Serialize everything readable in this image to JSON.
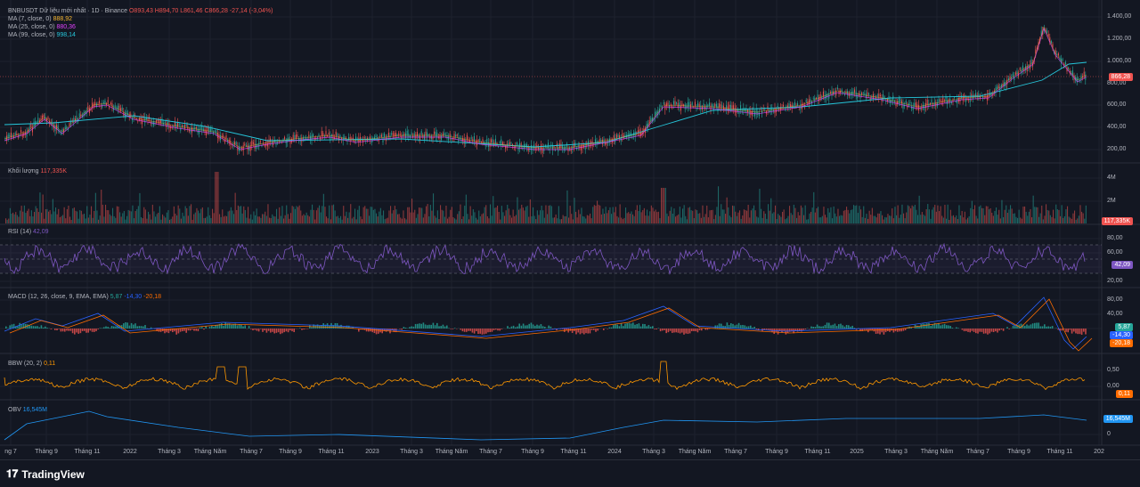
{
  "header": {
    "symbol": "BNBUSDT Dữ liệu mới nhất · 1D · Binance",
    "ohlc": "O893,43  H894,70  L861,46  C866,28  -27,14 (-3,04%)"
  },
  "ma": [
    {
      "label": "MA (7, close, 0)",
      "value": "888,92",
      "color": "#f7b731"
    },
    {
      "label": "MA (25, close, 0)",
      "value": "880,36",
      "color": "#e040fb"
    },
    {
      "label": "MA (99, close, 0)",
      "value": "998,14",
      "color": "#26c6da"
    }
  ],
  "price_axis": [
    "1.400,00",
    "1.200,00",
    "1.000,00",
    "800,00",
    "600,00",
    "400,00",
    "200,00"
  ],
  "price_tag": "866,28",
  "volume": {
    "label": "Khối lượng",
    "value": "117,335K",
    "axis": [
      "4M",
      "2M"
    ],
    "tag": "117,335K"
  },
  "rsi": {
    "label": "RSI (14)",
    "value": "42,09",
    "axis": [
      "80,00",
      "60,00",
      "40,00",
      "20,00"
    ],
    "tag": "42,09"
  },
  "macd": {
    "label": "MACD (12, 26, close, 9, EMA, EMA)",
    "v1": "5,87",
    "v2": "-14,30",
    "v3": "-20,18",
    "axis": [
      "80,00",
      "40,00",
      "0,00"
    ],
    "tag1": "5,87",
    "tag2": "-14,30",
    "tag3": "-20,18"
  },
  "bbw": {
    "label": "BBW (20, 2)",
    "value": "0,11",
    "axis": [
      "0,50",
      "0,00"
    ],
    "tag": "0,11"
  },
  "obv": {
    "label": "OBV",
    "value": "16,545M",
    "axis": [
      "0"
    ],
    "tag": "16,545M"
  },
  "time_axis": [
    "ng 7",
    "Tháng 9",
    "Tháng 11",
    "2022",
    "Tháng 3",
    "Tháng Năm",
    "Tháng 7",
    "Tháng 9",
    "Tháng 11",
    "2023",
    "Tháng 3",
    "Tháng Năm",
    "Tháng 7",
    "Tháng 9",
    "Tháng 11",
    "2024",
    "Tháng 3",
    "Tháng Năm",
    "Tháng 7",
    "Tháng 9",
    "Tháng 11",
    "2025",
    "Tháng 3",
    "Tháng Năm",
    "Tháng 7",
    "Tháng 9",
    "Tháng 11",
    "202"
  ],
  "brand": "TradingView",
  "colors": {
    "up": "#26a69a",
    "down": "#ef5350",
    "rsi": "#7e57c2",
    "macd": "#2962ff",
    "signal": "#ff6d00",
    "bbw": "#ff9800",
    "obv": "#2196f3"
  }
}
